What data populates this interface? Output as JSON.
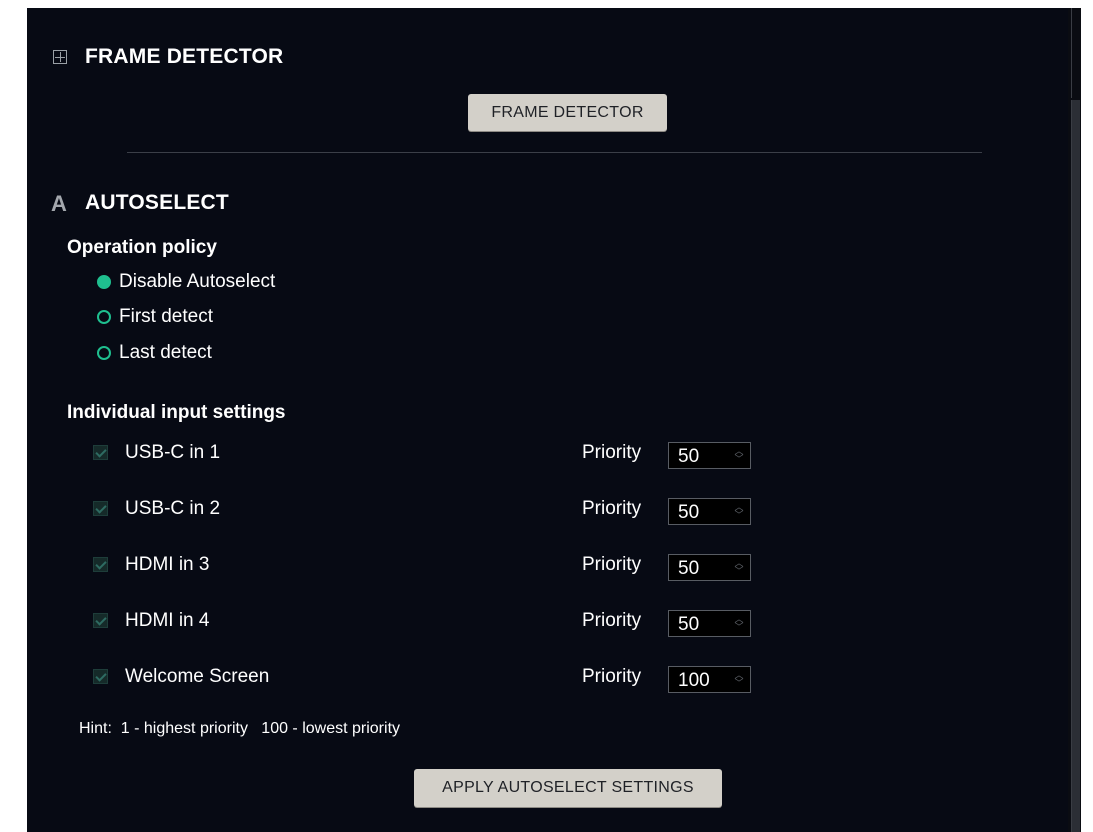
{
  "frame_detector": {
    "section_title": "FRAME DETECTOR",
    "button_label": "FRAME DETECTOR"
  },
  "autoselect": {
    "section_title": "AUTOSELECT",
    "icon_letter": "A",
    "operation_policy": {
      "label": "Operation policy",
      "options": [
        {
          "label": "Disable Autoselect",
          "selected": true
        },
        {
          "label": "First detect",
          "selected": false
        },
        {
          "label": "Last detect",
          "selected": false
        }
      ]
    },
    "individual": {
      "label": "Individual input settings",
      "priority_label": "Priority",
      "inputs": [
        {
          "name": "USB-C in 1",
          "checked": true,
          "priority": "50"
        },
        {
          "name": "USB-C in 2",
          "checked": true,
          "priority": "50"
        },
        {
          "name": "HDMI in 3",
          "checked": true,
          "priority": "50"
        },
        {
          "name": "HDMI in 4",
          "checked": true,
          "priority": "50"
        },
        {
          "name": "Welcome Screen",
          "checked": true,
          "priority": "100"
        }
      ]
    },
    "hint": "Hint:  1 - highest priority   100 - lowest priority",
    "apply_button_label": "APPLY AUTOSELECT SETTINGS"
  },
  "colors": {
    "background": "#070a14",
    "accent": "#1fbf8f",
    "button": "#d3d0c9"
  }
}
